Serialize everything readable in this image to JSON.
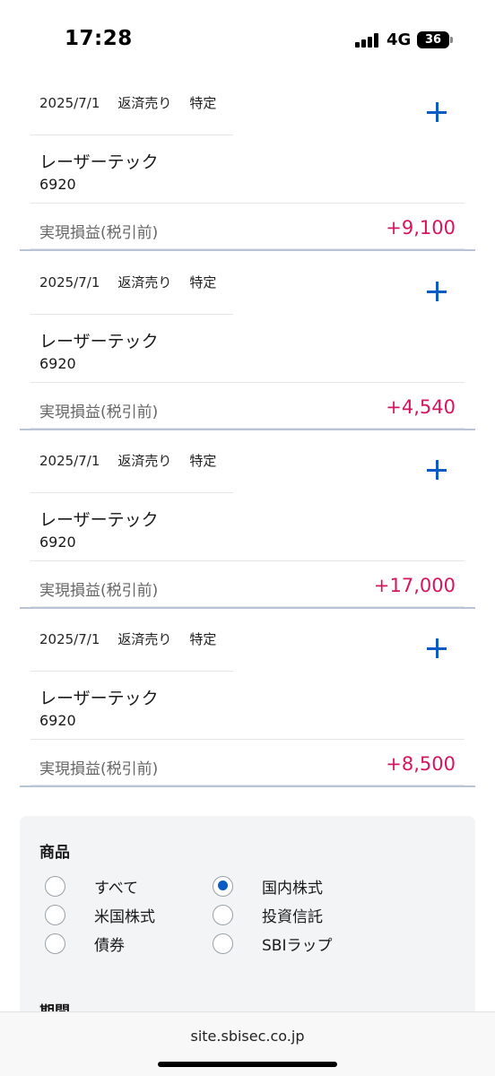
{
  "status_bar": {
    "time": "17:28",
    "network": "4G",
    "battery": "36"
  },
  "trades": [
    {
      "date": "2025/7/1",
      "type": "返済売り",
      "account": "特定",
      "name": "レーザーテック",
      "code": "6920",
      "pl_label": "実現損益(税引前)",
      "pl_value": "+9,100"
    },
    {
      "date": "2025/7/1",
      "type": "返済売り",
      "account": "特定",
      "name": "レーザーテック",
      "code": "6920",
      "pl_label": "実現損益(税引前)",
      "pl_value": "+4,540"
    },
    {
      "date": "2025/7/1",
      "type": "返済売り",
      "account": "特定",
      "name": "レーザーテック",
      "code": "6920",
      "pl_label": "実現損益(税引前)",
      "pl_value": "+17,000"
    },
    {
      "date": "2025/7/1",
      "type": "返済売り",
      "account": "特定",
      "name": "レーザーテック",
      "code": "6920",
      "pl_label": "実現損益(税引前)",
      "pl_value": "+8,500"
    }
  ],
  "filter": {
    "product_title": "商品",
    "options": [
      {
        "label": "すべて",
        "selected": false
      },
      {
        "label": "国内株式",
        "selected": true
      },
      {
        "label": "米国株式",
        "selected": false
      },
      {
        "label": "投資信託",
        "selected": false
      },
      {
        "label": "債券",
        "selected": false
      },
      {
        "label": "SBIラップ",
        "selected": false
      }
    ],
    "period_title": "期間"
  },
  "browser": {
    "url": "site.sbisec.co.jp"
  },
  "colors": {
    "accent": "#0a5bc4",
    "profit": "#d6145f"
  }
}
